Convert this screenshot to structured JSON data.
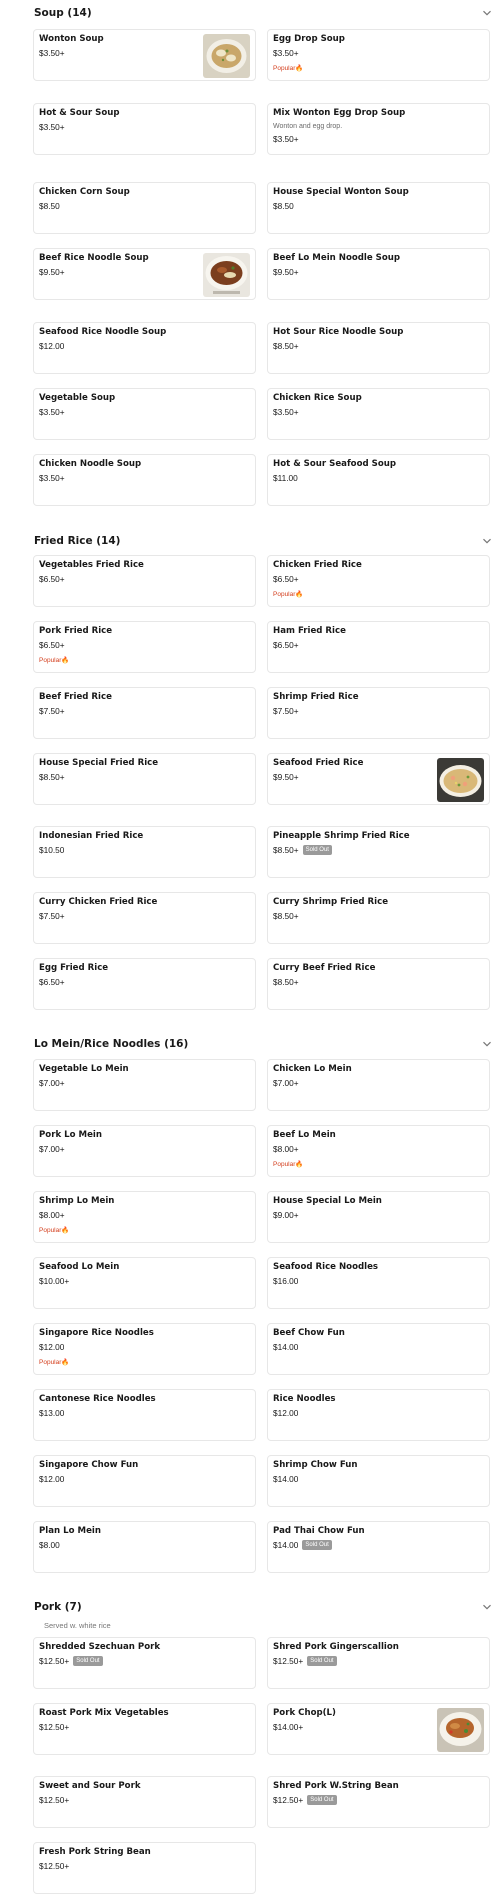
{
  "colors": {
    "card_border": "#e7e7e7",
    "popular": "#d4401f",
    "sold_out_badge": "#9a9a9a",
    "title": "#191919"
  },
  "icons": {
    "collapse": "chevron-down-icon",
    "popular": "flame-icon",
    "thumbnail": "food-photo-icon"
  },
  "soup": {
    "title": "Soup (14)",
    "items": [
      {
        "name": "Wonton Soup",
        "price": "$3.50+",
        "image": "wonton-soup-photo"
      },
      {
        "name": "Egg Drop Soup",
        "price": "$3.50+",
        "popular": "Popular"
      },
      {
        "name": "Hot & Sour Soup",
        "price": "$3.50+"
      },
      {
        "name": "Mix Wonton Egg Drop Soup",
        "desc": "Wonton and egg drop.",
        "price": "$3.50+"
      },
      {
        "name": "Chicken Corn Soup",
        "price": "$8.50"
      },
      {
        "name": "House Special Wonton Soup",
        "price": "$8.50"
      },
      {
        "name": "Beef Rice Noodle Soup",
        "price": "$9.50+",
        "image": "beef-noodle-soup-photo"
      },
      {
        "name": "Beef Lo Mein Noodle Soup",
        "price": "$9.50+"
      },
      {
        "name": "Seafood Rice Noodle Soup",
        "price": "$12.00"
      },
      {
        "name": "Hot Sour Rice Noodle Soup",
        "price": "$8.50+"
      },
      {
        "name": "Vegetable Soup",
        "price": "$3.50+"
      },
      {
        "name": "Chicken Rice Soup",
        "price": "$3.50+"
      },
      {
        "name": "Chicken Noodle Soup",
        "price": "$3.50+"
      },
      {
        "name": "Hot & Sour Seafood Soup",
        "price": "$11.00"
      }
    ]
  },
  "fried_rice": {
    "title": "Fried Rice (14)",
    "items": [
      {
        "name": "Vegetables Fried Rice",
        "price": "$6.50+"
      },
      {
        "name": "Chicken Fried Rice",
        "price": "$6.50+",
        "popular": "Popular"
      },
      {
        "name": "Pork Fried Rice",
        "price": "$6.50+",
        "popular": "Popular"
      },
      {
        "name": "Ham Fried Rice",
        "price": "$6.50+"
      },
      {
        "name": "Beef Fried Rice",
        "price": "$7.50+"
      },
      {
        "name": "Shrimp Fried Rice",
        "price": "$7.50+"
      },
      {
        "name": "House Special Fried Rice",
        "price": "$8.50+"
      },
      {
        "name": "Seafood Fried Rice",
        "price": "$9.50+",
        "image": "seafood-fried-rice-photo"
      },
      {
        "name": "Indonesian Fried Rice",
        "price": "$10.50"
      },
      {
        "name": "Pineapple Shrimp Fried Rice",
        "price": "$8.50+",
        "sold_out": "Sold Out"
      },
      {
        "name": "Curry Chicken Fried Rice",
        "price": "$7.50+"
      },
      {
        "name": "Curry Shrimp Fried Rice",
        "price": "$8.50+"
      },
      {
        "name": "Egg Fried Rice",
        "price": "$6.50+"
      },
      {
        "name": "Curry Beef Fried Rice",
        "price": "$8.50+"
      }
    ]
  },
  "lo_mein": {
    "title": "Lo Mein/Rice Noodles (16)",
    "items": [
      {
        "name": "Vegetable Lo Mein",
        "price": "$7.00+"
      },
      {
        "name": "Chicken Lo Mein",
        "price": "$7.00+"
      },
      {
        "name": "Pork Lo Mein",
        "price": "$7.00+"
      },
      {
        "name": "Beef Lo Mein",
        "price": "$8.00+",
        "popular": "Popular"
      },
      {
        "name": "Shrimp Lo Mein",
        "price": "$8.00+",
        "popular": "Popular"
      },
      {
        "name": "House Special Lo Mein",
        "price": "$9.00+"
      },
      {
        "name": "Seafood Lo Mein",
        "price": "$10.00+"
      },
      {
        "name": "Seafood Rice Noodles",
        "price": "$16.00"
      },
      {
        "name": "Singapore Rice Noodles",
        "price": "$12.00",
        "popular": "Popular"
      },
      {
        "name": "Beef Chow Fun",
        "price": "$14.00"
      },
      {
        "name": "Cantonese Rice Noodles",
        "price": "$13.00"
      },
      {
        "name": "Rice Noodles",
        "price": "$12.00"
      },
      {
        "name": "Singapore Chow Fun",
        "price": "$12.00"
      },
      {
        "name": "Shrimp Chow Fun",
        "price": "$14.00"
      },
      {
        "name": "Plan Lo Mein",
        "price": "$8.00"
      },
      {
        "name": "Pad Thai Chow Fun",
        "price": "$14.00",
        "sold_out": "Sold Out"
      }
    ]
  },
  "pork": {
    "title": "Pork (7)",
    "subtitle": "Served w. white rice",
    "items": [
      {
        "name": "Shredded Szechuan Pork",
        "price": "$12.50+",
        "sold_out": "Sold Out"
      },
      {
        "name": "Shred Pork Gingerscallion",
        "price": "$12.50+",
        "sold_out": "Sold Out"
      },
      {
        "name": "Roast Pork Mix Vegetables",
        "price": "$12.50+"
      },
      {
        "name": "Pork Chop(L)",
        "price": "$14.00+",
        "image": "pork-chop-photo"
      },
      {
        "name": "Sweet and Sour Pork",
        "price": "$12.50+"
      },
      {
        "name": "Shred Pork W.String Bean",
        "price": "$12.50+",
        "sold_out": "Sold Out"
      },
      {
        "name": "Fresh Pork String Bean",
        "price": "$12.50+"
      }
    ]
  }
}
